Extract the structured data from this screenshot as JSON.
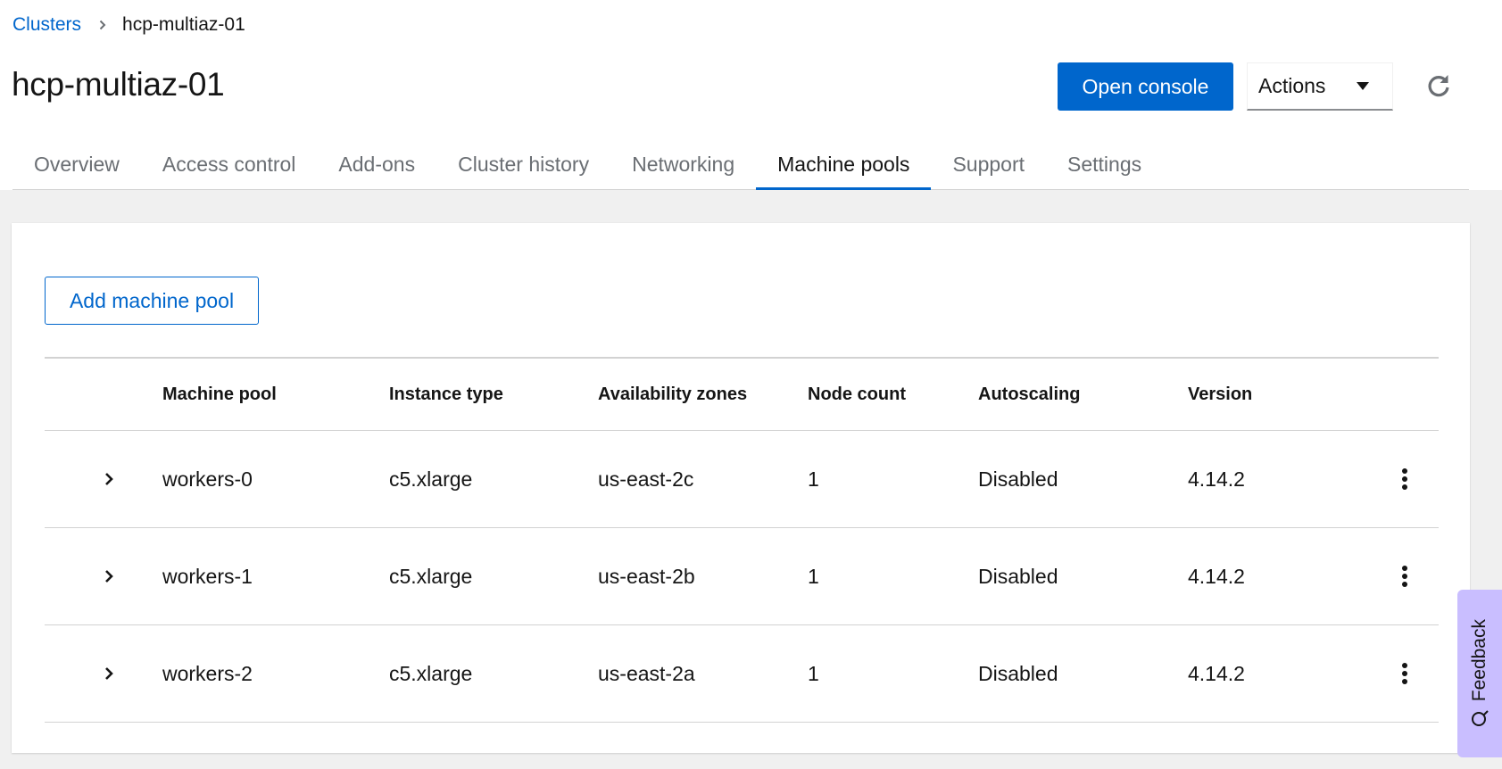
{
  "breadcrumb": {
    "parent": "Clusters",
    "current": "hcp-multiaz-01"
  },
  "page": {
    "title": "hcp-multiaz-01"
  },
  "toolbar": {
    "open_console": "Open console",
    "actions": "Actions"
  },
  "tabs": [
    {
      "label": "Overview"
    },
    {
      "label": "Access control"
    },
    {
      "label": "Add-ons"
    },
    {
      "label": "Cluster history"
    },
    {
      "label": "Networking"
    },
    {
      "label": "Machine pools",
      "active": true
    },
    {
      "label": "Support"
    },
    {
      "label": "Settings"
    }
  ],
  "machine_pools": {
    "add_button": "Add machine pool",
    "columns": [
      "Machine pool",
      "Instance type",
      "Availability zones",
      "Node count",
      "Autoscaling",
      "Version"
    ],
    "rows": [
      {
        "name": "workers-0",
        "instance_type": "c5.xlarge",
        "zone": "us-east-2c",
        "nodes": "1",
        "autoscaling": "Disabled",
        "version": "4.14.2"
      },
      {
        "name": "workers-1",
        "instance_type": "c5.xlarge",
        "zone": "us-east-2b",
        "nodes": "1",
        "autoscaling": "Disabled",
        "version": "4.14.2"
      },
      {
        "name": "workers-2",
        "instance_type": "c5.xlarge",
        "zone": "us-east-2a",
        "nodes": "1",
        "autoscaling": "Disabled",
        "version": "4.14.2"
      }
    ]
  },
  "feedback": {
    "label": "Feedback"
  },
  "colors": {
    "primary": "#0066cc",
    "feedback": "#c9beff",
    "background": "#f0f0f0"
  }
}
